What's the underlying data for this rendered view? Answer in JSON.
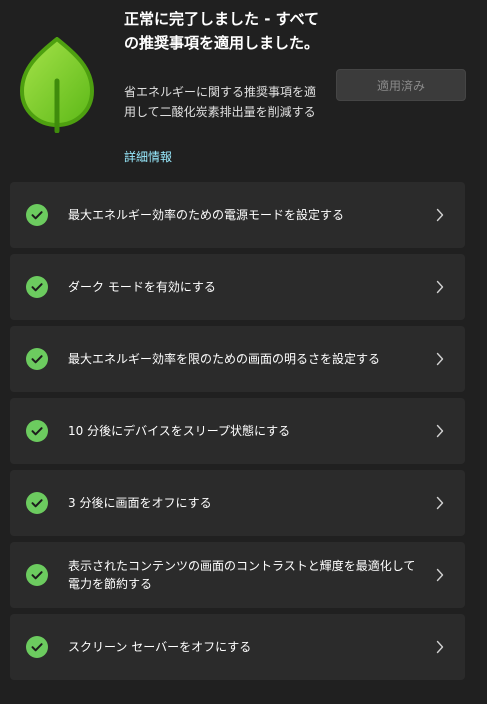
{
  "header": {
    "title": "正常に完了しました - すべての推奨事項を適用しました。",
    "description": "省エネルギーに関する推奨事項を適用して二酸化炭素排出量を削減する",
    "learn_more": "詳細情報",
    "applied_button": "適用済み"
  },
  "colors": {
    "leaf_light": "#86d633",
    "leaf_dark": "#5cb817",
    "check": "#6ccb5f",
    "link": "#99ebff"
  },
  "recommendations": [
    {
      "label": "最大エネルギー効率のための電源モードを設定する",
      "status": "applied"
    },
    {
      "label": "ダーク モードを有効にする",
      "status": "applied"
    },
    {
      "label": "最大エネルギー効率を限のための画面の明るさを設定する",
      "status": "applied"
    },
    {
      "label": "10 分後にデバイスをスリープ状態にする",
      "status": "applied"
    },
    {
      "label": "3 分後に画面をオフにする",
      "status": "applied"
    },
    {
      "label": "表示されたコンテンツの画面のコントラストと輝度を最適化して電力を節約する",
      "status": "applied"
    },
    {
      "label": "スクリーン セーバーをオフにする",
      "status": "applied"
    }
  ]
}
